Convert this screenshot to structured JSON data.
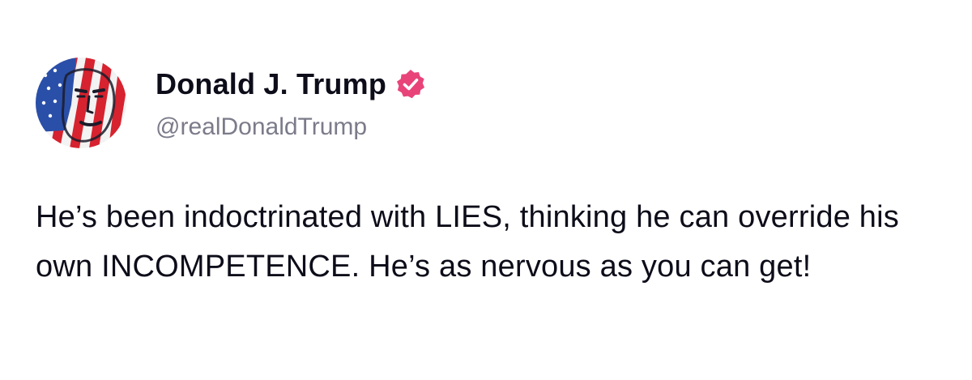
{
  "post": {
    "author": {
      "display_name": "Donald J. Trump",
      "handle": "@realDonaldTrump",
      "verified": true,
      "avatar_icon": "profile-avatar-flag-portrait",
      "verified_icon": "verified-badge-icon"
    },
    "text": "He’s been indoctrinated with LIES, thinking he can override his own INCOMPETENCE. He’s as nervous as you can get!"
  },
  "colors": {
    "verified_badge": "#e8447a",
    "text": "#0d0d1a",
    "handle": "#7b7b8a",
    "background": "#ffffff"
  }
}
